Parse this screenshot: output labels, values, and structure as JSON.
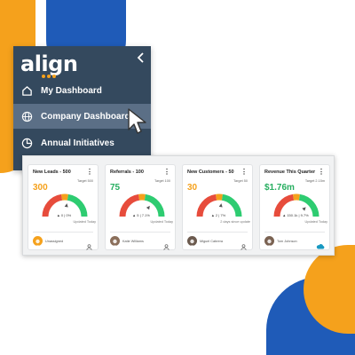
{
  "sidebar": {
    "logo_text": "align",
    "collapse_icon": "chevron-left-icon",
    "items": [
      {
        "label": "My Dashboard",
        "icon": "home-icon",
        "active": false
      },
      {
        "label": "Company Dashboard",
        "icon": "globe-icon",
        "active": true
      },
      {
        "label": "Annual Initiatives",
        "icon": "pie-chart-icon",
        "active": false
      }
    ]
  },
  "cards": [
    {
      "title": "New Leads - 500",
      "target": "Target 500",
      "value": "300",
      "value_color": "#f5a11c",
      "gauge_level": 0.55,
      "change": "▲ 0 | 0%",
      "updated": "Updated Today",
      "owner": "Unassigned",
      "owner_icon": "user-icon"
    },
    {
      "title": "Referrals - 100",
      "target": "Target 100",
      "value": "75",
      "value_color": "#27ae60",
      "gauge_level": 0.7,
      "change": "▲ 5 | 7.1%",
      "updated": "Updated Today",
      "owner": "Katie Williams",
      "owner_icon": "user-icon"
    },
    {
      "title": "New Customers - 50",
      "target": "Target 50",
      "value": "30",
      "value_color": "#f5a11c",
      "gauge_level": 0.55,
      "change": "▲ 2 | 7%",
      "updated": "2 days since update",
      "owner": "Miguel Cabrera",
      "owner_icon": "user-icon"
    },
    {
      "title": "Revenue This Quarter",
      "target": "Target 2.15m",
      "value": "$1.76m",
      "value_color": "#27ae60",
      "gauge_level": 0.75,
      "change": "▲ 150.1k | 9.7%",
      "updated": "Updated Today",
      "owner": "Tom Johnson",
      "owner_icon": "salesforce-cloud-icon"
    }
  ],
  "colors": {
    "sidebar_bg": "#34495e",
    "active_item_bg": "#5b6f86",
    "brand_orange": "#f5a11c",
    "brand_blue": "#1f5bb8",
    "gauge_red": "#e74c3c",
    "gauge_orange": "#f5a11c",
    "gauge_green": "#2ecc71"
  }
}
